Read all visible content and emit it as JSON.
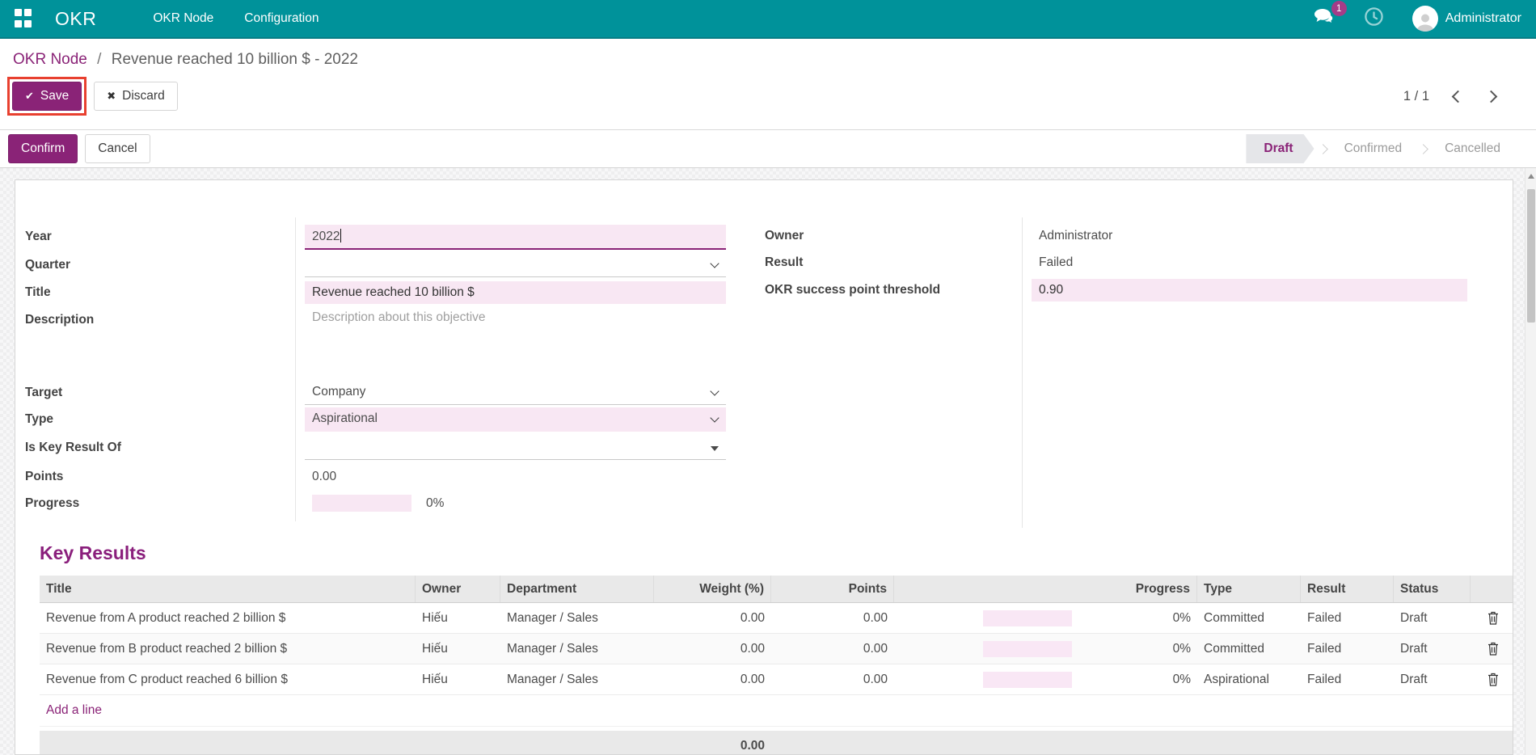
{
  "colors": {
    "navbar_teal": "#00929a",
    "accent_purple": "#8a2377",
    "field_pink": "#f8e7f3",
    "annotation_red": "#e8402f",
    "badge_magenta": "#a43c88"
  },
  "icons": {
    "apps": "apps-grid-icon",
    "messages": "chat-bubbles-icon",
    "activity": "clock-icon",
    "user": "avatar",
    "save": "check-icon",
    "discard": "close-icon",
    "pager_prev": "chevron-left-icon",
    "pager_next": "chevron-right-icon",
    "select": "chevron-down-icon",
    "many2one": "caret-down-icon",
    "delete_row": "trash-icon",
    "scroll_up": "up-arrow-icon"
  },
  "navbar": {
    "brand": "OKR",
    "menu_okr_node": "OKR Node",
    "menu_configuration": "Configuration",
    "message_badge": "1",
    "user_name": "Administrator"
  },
  "breadcrumb": {
    "parent": "OKR Node",
    "separator": "/",
    "current": "Revenue reached 10 billion $ - 2022"
  },
  "actions": {
    "save": "Save",
    "discard": "Discard",
    "confirm": "Confirm",
    "cancel": "Cancel"
  },
  "pager": {
    "value": "1 / 1"
  },
  "statusbar": {
    "active_step": "Draft",
    "draft": "Draft",
    "confirmed": "Confirmed",
    "cancelled": "Cancelled"
  },
  "form": {
    "year": {
      "label": "Year",
      "value": "2022"
    },
    "quarter": {
      "label": "Quarter",
      "value": ""
    },
    "title": {
      "label": "Title",
      "value": "Revenue reached 10 billion $"
    },
    "description": {
      "label": "Description",
      "placeholder": "Description about this objective"
    },
    "target": {
      "label": "Target",
      "value": "Company"
    },
    "type": {
      "label": "Type",
      "value": "Aspirational"
    },
    "is_key_result_of": {
      "label": "Is Key Result Of",
      "value": ""
    },
    "points": {
      "label": "Points",
      "value": "0.00"
    },
    "progress": {
      "label": "Progress",
      "value": "0%",
      "percent": 0
    },
    "owner": {
      "label": "Owner",
      "value": "Administrator"
    },
    "result": {
      "label": "Result",
      "value": "Failed"
    },
    "threshold": {
      "label": "OKR success point threshold",
      "value": "0.90"
    }
  },
  "key_results": {
    "heading": "Key Results",
    "columns": [
      "Title",
      "Owner",
      "Department",
      "Weight (%)",
      "Points",
      "Progress",
      "Type",
      "Result",
      "Status"
    ],
    "rows": [
      {
        "title": "Revenue from A product reached 2 billion $",
        "owner": "Hiếu",
        "department": "Manager / Sales",
        "weight": "0.00",
        "points": "0.00",
        "progress": "0%",
        "progress_percent": 0,
        "type": "Committed",
        "result": "Failed",
        "status": "Draft"
      },
      {
        "title": "Revenue from B product reached 2 billion $",
        "owner": "Hiếu",
        "department": "Manager / Sales",
        "weight": "0.00",
        "points": "0.00",
        "progress": "0%",
        "progress_percent": 0,
        "type": "Committed",
        "result": "Failed",
        "status": "Draft"
      },
      {
        "title": "Revenue from C product reached 6 billion $",
        "owner": "Hiếu",
        "department": "Manager / Sales",
        "weight": "0.00",
        "points": "0.00",
        "progress": "0%",
        "progress_percent": 0,
        "type": "Aspirational",
        "result": "Failed",
        "status": "Draft"
      }
    ],
    "add_line": "Add a line",
    "footer_total_weight": "0.00"
  }
}
